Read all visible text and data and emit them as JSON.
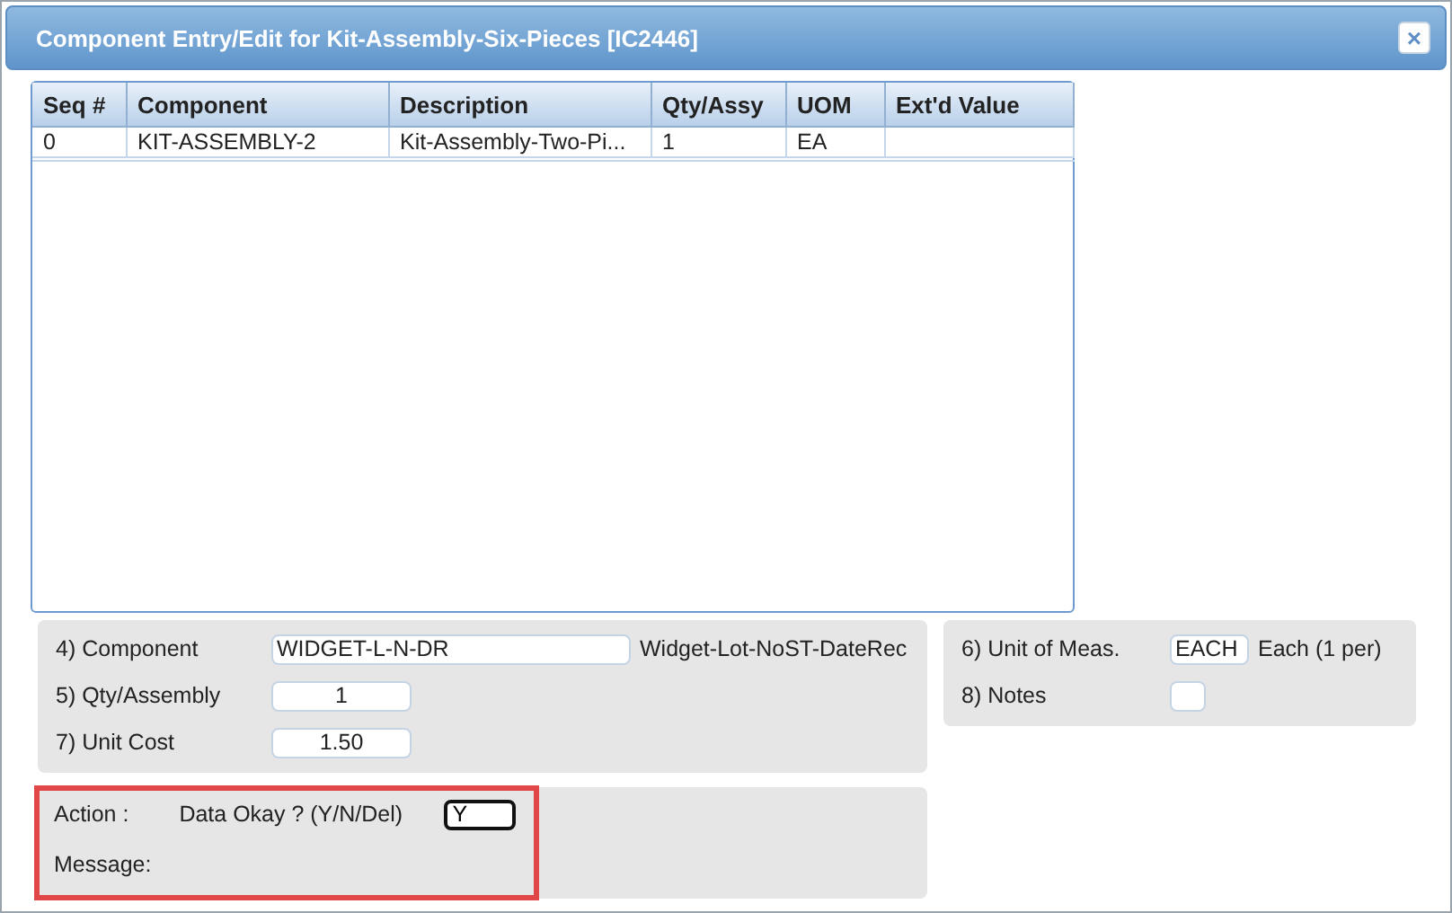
{
  "window": {
    "title": "Component Entry/Edit for Kit-Assembly-Six-Pieces [IC2446]",
    "close": "×"
  },
  "table": {
    "columns": [
      "Seq #",
      "Component",
      "Description",
      "Qty/Assy",
      "UOM",
      "Ext'd Value"
    ],
    "rows": [
      {
        "cells": [
          "0",
          "KIT-ASSEMBLY-2",
          "Kit-Assembly-Two-Pi...",
          "1",
          "EA",
          ""
        ],
        "selected": false
      }
    ]
  },
  "form_left": [
    {
      "label": "4) Component",
      "value": "WIDGET-L-N-DR",
      "kind": "wide",
      "note": "Widget-Lot-NoST-DateRec"
    },
    {
      "label": "5) Qty/Assembly",
      "value": "1",
      "kind": "number"
    },
    {
      "label": "7) Unit Cost",
      "value": "1.50",
      "kind": "number"
    }
  ],
  "form_right": [
    {
      "label": "6) Unit of Meas.",
      "value": "EACH",
      "kind": "short",
      "note": "Each (1 per)"
    },
    {
      "label": "8) Notes",
      "kind": "tiny"
    }
  ],
  "action": {
    "label": "Action :",
    "prompt": "Data Okay ? (Y/N/Del)",
    "value": "Y",
    "message_label": "Message:",
    "highlighted": true
  }
}
